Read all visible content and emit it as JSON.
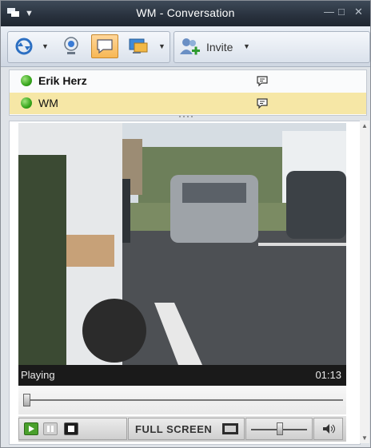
{
  "window": {
    "title": "WM - Conversation"
  },
  "toolbar": {
    "invite_label": "Invite"
  },
  "participants": [
    {
      "name": "Erik Herz",
      "bold": true,
      "selected": false
    },
    {
      "name": "WM",
      "bold": false,
      "selected": true
    }
  ],
  "player": {
    "status": "Playing",
    "time": "01:13",
    "fullscreen_label": "FULL SCREEN",
    "seek_position": 0.0,
    "volume_level": 0.5
  },
  "colors": {
    "selected_row": "#f6e7a6",
    "active_button": "#f7b755",
    "presence_online": "#37a51c"
  }
}
